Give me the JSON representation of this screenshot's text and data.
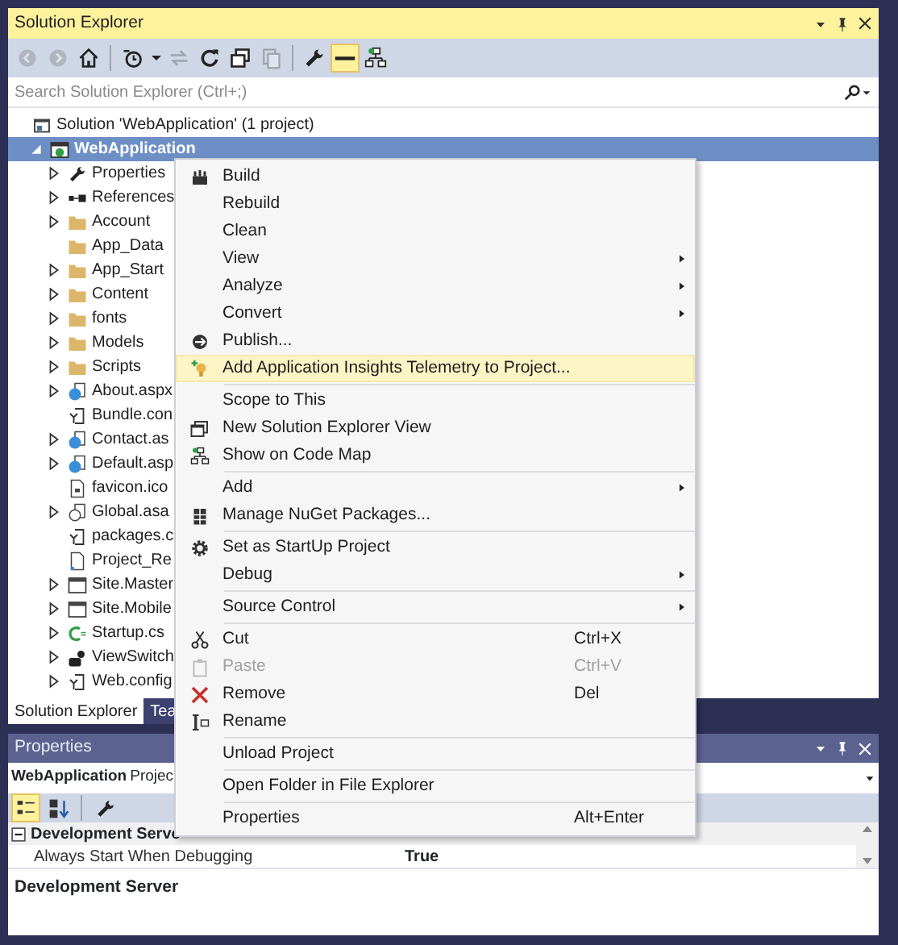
{
  "solution_explorer": {
    "title": "Solution Explorer",
    "toolbar": [
      {
        "kind": "back",
        "disabled": true,
        "selected": false
      },
      {
        "kind": "forward",
        "disabled": true,
        "selected": false
      },
      {
        "kind": "home",
        "disabled": false,
        "selected": false
      },
      {
        "kind": "sep"
      },
      {
        "kind": "history",
        "disabled": false,
        "selected": false
      },
      {
        "kind": "dropdown",
        "disabled": false,
        "selected": false
      },
      {
        "kind": "sync",
        "disabled": true,
        "selected": false
      },
      {
        "kind": "refresh",
        "disabled": false,
        "selected": false
      },
      {
        "kind": "collapse",
        "disabled": false,
        "selected": false
      },
      {
        "kind": "showall",
        "disabled": true,
        "selected": false
      },
      {
        "kind": "sep"
      },
      {
        "kind": "properties",
        "disabled": false,
        "selected": false
      },
      {
        "kind": "preview",
        "disabled": false,
        "selected": true
      },
      {
        "kind": "codemap",
        "disabled": false,
        "selected": false
      }
    ],
    "search": {
      "placeholder": "Search Solution Explorer (Ctrl+;)"
    },
    "tree": [
      {
        "label": "Solution 'WebApplication' (1 project)",
        "kind": "solution",
        "selected": false,
        "children": [
          {
            "label": "WebApplication",
            "kind": "project",
            "expanded": true,
            "selected": true,
            "children": [
              {
                "label": "Properties",
                "kind": "wrench",
                "expanded": false,
                "selected": false
              },
              {
                "label": "References",
                "kind": "refs",
                "expanded": false,
                "selected": false
              },
              {
                "label": "Account",
                "kind": "folder",
                "expanded": false,
                "selected": false
              },
              {
                "label": "App_Data",
                "kind": "folder",
                "selected": false
              },
              {
                "label": "App_Start",
                "kind": "folder",
                "expanded": false,
                "selected": false
              },
              {
                "label": "Content",
                "kind": "folder",
                "expanded": false,
                "selected": false
              },
              {
                "label": "fonts",
                "kind": "folder",
                "expanded": false,
                "selected": false
              },
              {
                "label": "Models",
                "kind": "folder",
                "expanded": false,
                "selected": false
              },
              {
                "label": "Scripts",
                "kind": "folder",
                "expanded": false,
                "selected": false
              },
              {
                "label": "About.aspx",
                "kind": "page",
                "expanded": false,
                "selected": false
              },
              {
                "label": "Bundle.con",
                "kind": "config",
                "selected": false
              },
              {
                "label": "Contact.as",
                "kind": "page",
                "expanded": false,
                "selected": false
              },
              {
                "label": "Default.asp",
                "kind": "page",
                "expanded": false,
                "selected": false
              },
              {
                "label": "favicon.ico",
                "kind": "file",
                "selected": false
              },
              {
                "label": "Global.asa",
                "kind": "global",
                "expanded": false,
                "selected": false
              },
              {
                "label": "packages.c",
                "kind": "config",
                "selected": false
              },
              {
                "label": "Project_Re",
                "kind": "readme",
                "selected": false
              },
              {
                "label": "Site.Master",
                "kind": "master",
                "expanded": false,
                "selected": false
              },
              {
                "label": "Site.Mobile",
                "kind": "master",
                "expanded": false,
                "selected": false
              },
              {
                "label": "Startup.cs",
                "kind": "cs",
                "expanded": false,
                "selected": false
              },
              {
                "label": "ViewSwitch",
                "kind": "control",
                "expanded": false,
                "selected": false
              },
              {
                "label": "Web.config",
                "kind": "config",
                "expanded": false,
                "selected": false
              }
            ]
          }
        ]
      }
    ],
    "tabs": [
      {
        "label": "Solution Explorer",
        "selected": true
      },
      {
        "label": "Tea",
        "selected": false
      }
    ]
  },
  "context_menu": [
    {
      "kind": "item",
      "label": "Build",
      "selected": false,
      "disabled": false
    },
    {
      "kind": "item",
      "label": "Rebuild",
      "selected": false,
      "disabled": false
    },
    {
      "kind": "item",
      "label": "Clean",
      "selected": false,
      "disabled": false
    },
    {
      "kind": "item",
      "label": "View",
      "submenu": true,
      "selected": false,
      "disabled": false
    },
    {
      "kind": "item",
      "label": "Analyze",
      "submenu": true,
      "selected": false,
      "disabled": false
    },
    {
      "kind": "item",
      "label": "Convert",
      "submenu": true,
      "selected": false,
      "disabled": false
    },
    {
      "kind": "item",
      "label": "Publish...",
      "selected": false,
      "disabled": false
    },
    {
      "kind": "item",
      "label": "Add Application Insights Telemetry to Project...",
      "selected": true,
      "disabled": false
    },
    {
      "kind": "separator"
    },
    {
      "kind": "item",
      "label": "Scope to This",
      "selected": false,
      "disabled": false
    },
    {
      "kind": "item",
      "label": "New Solution Explorer View",
      "selected": false,
      "disabled": false
    },
    {
      "kind": "item",
      "label": "Show on Code Map",
      "selected": false,
      "disabled": false
    },
    {
      "kind": "separator"
    },
    {
      "kind": "item",
      "label": "Add",
      "submenu": true,
      "selected": false,
      "disabled": false
    },
    {
      "kind": "item",
      "label": "Manage NuGet Packages...",
      "selected": false,
      "disabled": false
    },
    {
      "kind": "separator"
    },
    {
      "kind": "item",
      "label": "Set as StartUp Project",
      "selected": false,
      "disabled": false
    },
    {
      "kind": "item",
      "label": "Debug",
      "submenu": true,
      "selected": false,
      "disabled": false
    },
    {
      "kind": "separator"
    },
    {
      "kind": "item",
      "label": "Source Control",
      "submenu": true,
      "selected": false,
      "disabled": false
    },
    {
      "kind": "separator"
    },
    {
      "kind": "item",
      "label": "Cut",
      "shortcut": "Ctrl+X",
      "selected": false,
      "disabled": false
    },
    {
      "kind": "item",
      "label": "Paste",
      "shortcut": "Ctrl+V",
      "selected": false,
      "disabled": true
    },
    {
      "kind": "item",
      "label": "Remove",
      "shortcut": "Del",
      "selected": false,
      "disabled": false
    },
    {
      "kind": "item",
      "label": "Rename",
      "selected": false,
      "disabled": false
    },
    {
      "kind": "separator"
    },
    {
      "kind": "item",
      "label": "Unload Project",
      "selected": false,
      "disabled": false
    },
    {
      "kind": "separator"
    },
    {
      "kind": "item",
      "label": "Open Folder in File Explorer",
      "selected": false,
      "disabled": false
    },
    {
      "kind": "separator"
    },
    {
      "kind": "item",
      "label": "Properties",
      "shortcut": "Alt+Enter",
      "selected": false,
      "disabled": false
    }
  ],
  "properties": {
    "title": "Properties",
    "object_name": "WebApplication",
    "object_type": "Projec",
    "toolbar": [
      {
        "kind": "categorized",
        "selected": true
      },
      {
        "kind": "alphabetical",
        "selected": false
      },
      {
        "kind": "pages",
        "selected": false
      }
    ],
    "category": {
      "label": "Development Serve",
      "expanded": true
    },
    "rows": [
      {
        "name": "Always Start When Debugging",
        "value": "True"
      }
    ],
    "description": "Development Server"
  }
}
